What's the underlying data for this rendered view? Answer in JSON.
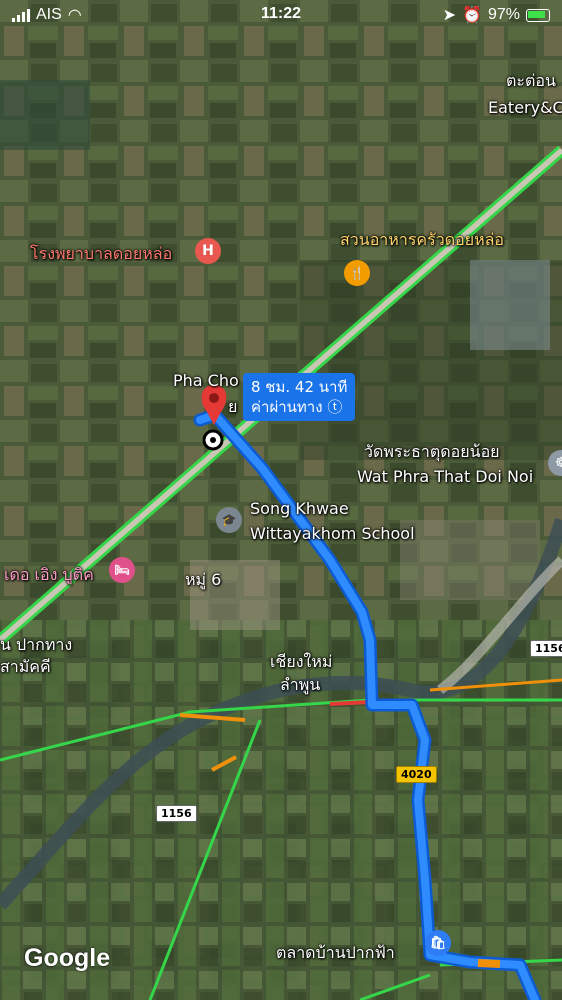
{
  "status_bar": {
    "carrier": "AIS",
    "time": "11:22",
    "battery": "97%"
  },
  "map_labels": {
    "eatery_line1": "ตะต่อน",
    "eatery_line2": "Eatery&C",
    "hospital": "โรงพยาบาลดอยหล่อ",
    "restaurant": "สวนอาหารครัวดอยหล่อ",
    "pha_cho": "Pha Cho",
    "pha_cho_tail": "ย",
    "temple_thai": "วัดพระธาตุดอยน้อย",
    "temple_en": "Wat Phra That Doi Noi",
    "school_line1": "Song Khwae",
    "school_line2": "Wittayakhom School",
    "hotel": "เดอ เอิง บูติค",
    "moo6": "หมู่ 6",
    "pakthang_line1": "น ปากทาง",
    "pakthang_line2": "สามัคคี",
    "province_line1": "เชียงใหม่",
    "province_line2": "ลำพูน",
    "market": "ตลาดบ้านปากฟ้า"
  },
  "route": {
    "duration": "8 ชม. 42 นาที",
    "toll": "ค่าผ่านทาง ⓣ"
  },
  "road_shields": {
    "r4020": "4020",
    "r1156_right": "1156",
    "r1156_left": "1156"
  },
  "icons": {
    "hospital_icon": "H",
    "restaurant_icon": "🍴",
    "hotel_icon": "🛏",
    "school_icon": "🎓"
  },
  "colors": {
    "route": "#2f8cff",
    "route_outline": "#0d5bd1",
    "traffic_green": "#35d64a",
    "traffic_orange": "#f0900a",
    "pin": "#e53935"
  },
  "attribution": "Google"
}
